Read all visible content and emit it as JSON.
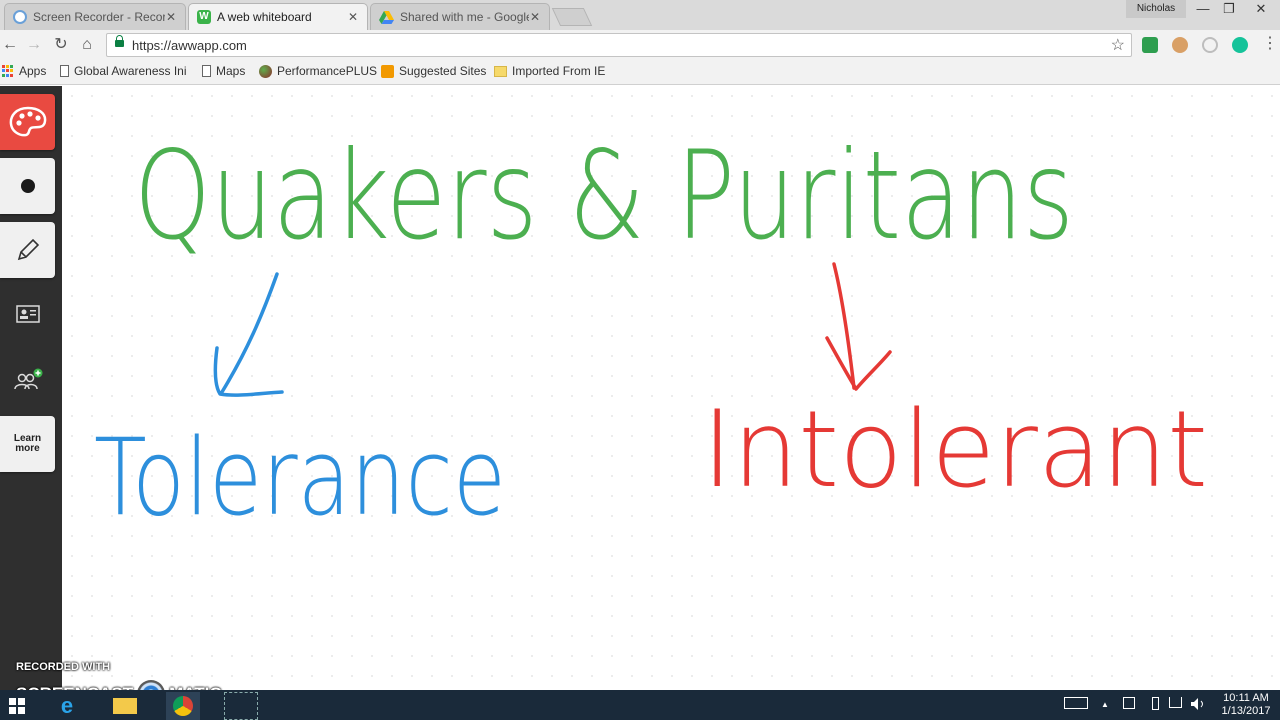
{
  "browser": {
    "tabs": [
      {
        "title": "Screen Recorder - Recor",
        "favicon": "screen-recorder-icon"
      },
      {
        "title": "A web whiteboard",
        "favicon": "awwapp-icon",
        "active": true
      },
      {
        "title": "Shared with me - Google",
        "favicon": "google-drive-icon"
      }
    ],
    "tab_close": "✕",
    "profile_name": "Nicholas",
    "window_controls": {
      "minimize": "—",
      "restore": "❐",
      "close": "✕"
    },
    "nav": {
      "back": "←",
      "forward": "→",
      "reload": "↻",
      "home": "⌂"
    },
    "url": "https://awwapp.com",
    "star": "☆",
    "menu": "⋮"
  },
  "bookmarks": [
    {
      "label": "Apps",
      "icon": "apps-grid-icon"
    },
    {
      "label": "Global Awareness Ini",
      "icon": "page-icon"
    },
    {
      "label": "Maps",
      "icon": "page-icon"
    },
    {
      "label": "PerformancePLUS",
      "icon": "globe-icon"
    },
    {
      "label": "Suggested Sites",
      "icon": "suggested-sites-icon"
    },
    {
      "label": "Imported From IE",
      "icon": "folder-icon"
    }
  ],
  "tools": [
    {
      "name": "palette",
      "icon": "palette-icon",
      "active": true
    },
    {
      "name": "brush-size",
      "icon": "dot-icon"
    },
    {
      "name": "pencil",
      "icon": "pencil-icon"
    },
    {
      "name": "whiteboard-card",
      "icon": "contact-card-icon"
    },
    {
      "name": "invite",
      "icon": "add-users-icon"
    },
    {
      "name": "learn-more",
      "label_line1": "Learn",
      "label_line2": "more"
    }
  ],
  "whiteboard": {
    "heading": "Quakers & Puritans",
    "left_word": "Tolerance",
    "right_word": "Intolerant",
    "colors": {
      "heading": "#4caf50",
      "left": "#2d8fdc",
      "right": "#e53935"
    }
  },
  "watermark": {
    "line1": "RECORDED WITH",
    "line2_a": "SCREENCAST",
    "line2_b": "MATIC"
  },
  "taskbar": {
    "time": "10:11 AM",
    "date": "1/13/2017",
    "tray_up": "▲"
  }
}
